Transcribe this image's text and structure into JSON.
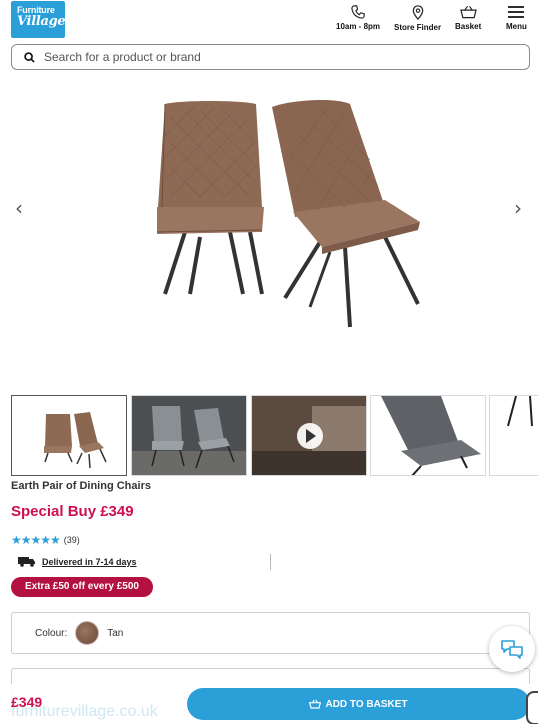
{
  "brand": {
    "line1": "Furniture",
    "line2": "Village"
  },
  "header_nav": {
    "phone": "10am - 8pm",
    "store_finder": "Store Finder",
    "basket": "Basket",
    "menu": "Menu"
  },
  "search": {
    "placeholder": "Search for a product or brand"
  },
  "carousel": {
    "prev": "‹",
    "next": "›"
  },
  "product": {
    "title": "Earth Pair of Dining Chairs",
    "price_label": "Special Buy £349",
    "review_count": "(39)",
    "rating": 4.5,
    "delivery": "Delivered in 7-14 days",
    "offer": "Extra £50 off every £500",
    "colour_label": "Colour:",
    "colour_value": "Tan"
  },
  "sticky": {
    "ghost_text": "furniturevillage.co.uk",
    "price": "£349",
    "add_to_basket": "ADD TO BASKET"
  },
  "colors": {
    "brand_blue": "#2b9fd8",
    "price_red": "#d0104c",
    "offer_red": "#b3113f",
    "chair_tan": "#8e6a55"
  }
}
